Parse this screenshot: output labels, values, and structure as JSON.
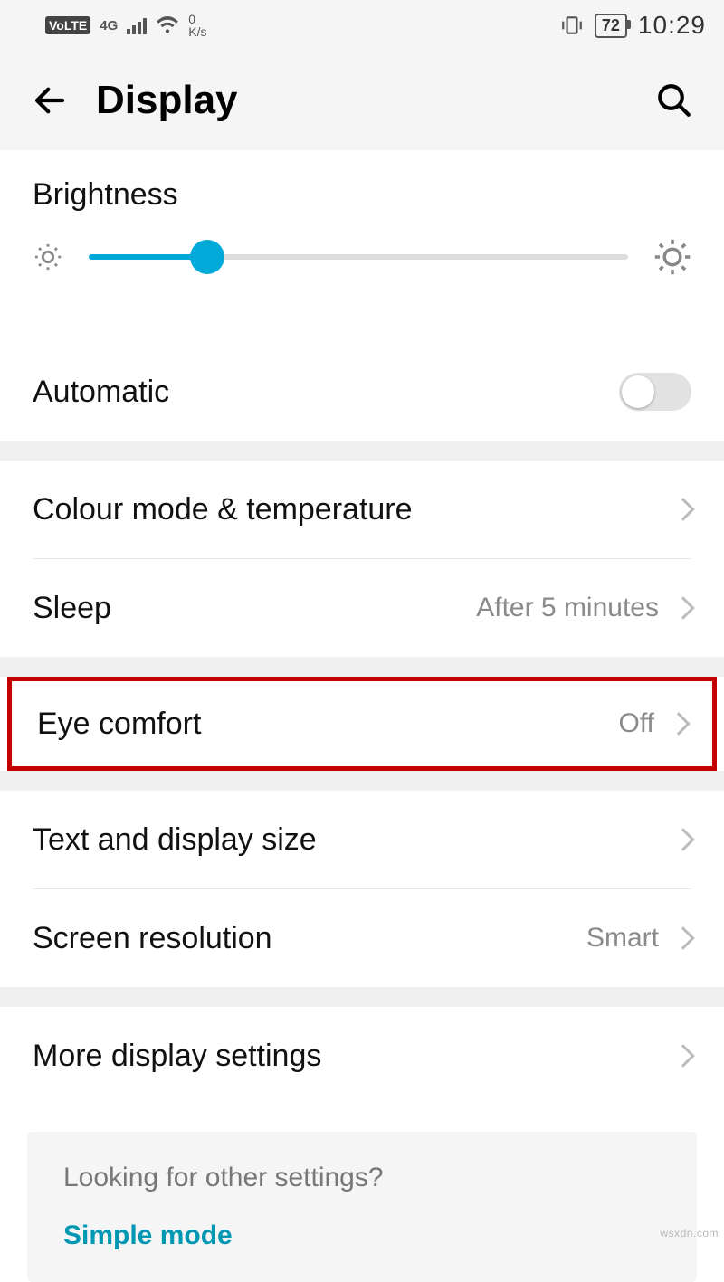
{
  "status": {
    "volte": "VoLTE",
    "network_gen": "4G",
    "speed_value": "0",
    "speed_unit": "K/s",
    "battery": "72",
    "time": "10:29"
  },
  "header": {
    "title": "Display"
  },
  "brightness": {
    "label": "Brightness",
    "value_percent": 22
  },
  "rows": {
    "automatic": "Automatic",
    "colour_mode": "Colour mode & temperature",
    "sleep_label": "Sleep",
    "sleep_value": "After 5 minutes",
    "eye_comfort_label": "Eye comfort",
    "eye_comfort_value": "Off",
    "text_size": "Text and display size",
    "resolution_label": "Screen resolution",
    "resolution_value": "Smart",
    "more": "More display settings"
  },
  "footer": {
    "question": "Looking for other settings?",
    "link": "Simple mode"
  },
  "watermark": "wsxdn.com"
}
